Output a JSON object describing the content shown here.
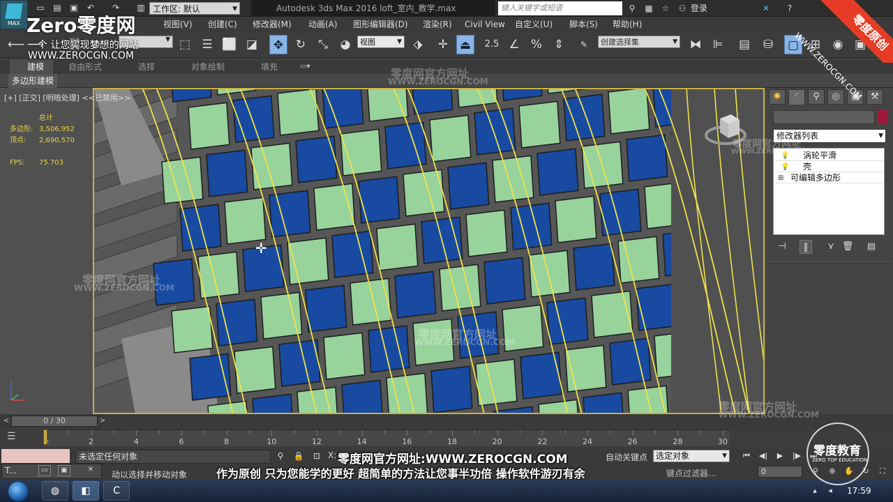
{
  "app": {
    "logo_label": "MAX",
    "workspace": "工作区: 默认",
    "title": "Autodesk 3ds Max 2016      loft_室内_教学.max",
    "search_placeholder": "键入关键字或短语",
    "login": "登录"
  },
  "menus": [
    {
      "label": "视图(V)"
    },
    {
      "label": "创建(C)"
    },
    {
      "label": "修改器(M)"
    },
    {
      "label": "动画(A)"
    },
    {
      "label": "图形编辑器(D)"
    },
    {
      "label": "渲染(R)"
    },
    {
      "label": "Civil View"
    },
    {
      "label": "自定义(U)"
    },
    {
      "label": "脚本(S)"
    },
    {
      "label": "帮助(H)"
    }
  ],
  "toolbar": {
    "ref_coord": "视图",
    "named_selection_set": "创建选择集",
    "snap_value": "2.5"
  },
  "ribbon": {
    "tabs": [
      "建模",
      "自由形式",
      "选择",
      "对象绘制",
      "填充"
    ],
    "active_tab": 0,
    "panel_label": "多边形建模"
  },
  "viewport": {
    "label": "[+] [正交] [明暗处理]  <<已禁用>>",
    "stats_heading": "总计",
    "stats": [
      {
        "k": "多边形:",
        "v": "3,506,952"
      },
      {
        "k": "顶点:",
        "v": "2,690,570"
      }
    ],
    "fps_label": "FPS:",
    "fps_value": "75.703",
    "colors": {
      "blue_tile": "#174aa0",
      "green_tile": "#98d39c",
      "gray_floor": "#5a5a5a",
      "spline": "#f0e24a",
      "frame": "#c9b14a"
    }
  },
  "command_panel": {
    "modifier_list": "修改器列表",
    "object_color": "#9e1a3c",
    "stack": [
      {
        "icon": "light-bulb-icon",
        "label": "涡轮平滑"
      },
      {
        "icon": "light-bulb-icon",
        "label": "壳"
      },
      {
        "icon": "expand-plus-icon",
        "label": "可编辑多边形"
      }
    ]
  },
  "timeline": {
    "slider_text": "0 / 30",
    "ticks": [
      0,
      2,
      4,
      6,
      8,
      10,
      12,
      14,
      16,
      18,
      20,
      22,
      24,
      26,
      28,
      30
    ],
    "current_frame": 0
  },
  "status": {
    "selection_msg": "未选定任何对象",
    "prompt_msg": "动以选择并移动对象",
    "x_label": "X:",
    "autokey": "自动关键点",
    "key_filter_sel": "选定对象",
    "setkey_filter": "键点过滤器...",
    "frame_field": "0",
    "mini_window_label": "T..."
  },
  "taskbar": {
    "clock": "17:59"
  },
  "watermarks": {
    "brand": "Zero零度网",
    "slogan": "一个 让您实现梦想的网站",
    "url": "WWW.ZEROCGN.COM",
    "corner_badge": "零度原创",
    "corner_url": "WWW.ZEROCGN.COM",
    "faint_1": "零度网官方网址",
    "faint_url": "WWW.ZEROCGN.COM",
    "caption_1": "零度网官方网址:WWW.ZEROCGN.COM",
    "caption_2": "作为原创 只为您能学的更好 超简单的方法让您事半功倍 操作软件游刃有余",
    "edu_title": "零度教育",
    "edu_sub": "ZERO TOP EDUCATION"
  }
}
